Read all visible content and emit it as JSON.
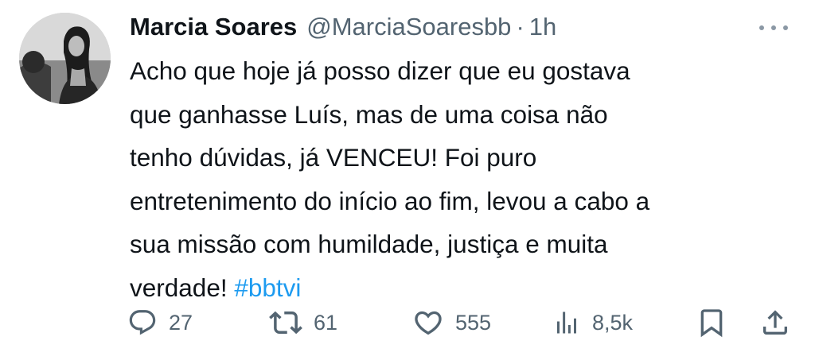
{
  "tweet": {
    "author_name": "Marcia Soares",
    "handle": "@MarciaSoaresbb",
    "separator": "·",
    "time": "1h",
    "text_lines": [
      "Acho que hoje já posso dizer que eu gostava",
      "que ganhasse Luís, mas de uma coisa não",
      "tenho dúvidas, já VENCEU! Foi puro",
      "entretenimento do início ao fim, levou a cabo a",
      "sua missão com humildade, justiça e muita",
      "verdade! "
    ],
    "hashtag": "#bbtvi"
  },
  "actions": {
    "replies": "27",
    "retweets": "61",
    "likes": "555",
    "views": "8,5k"
  },
  "icons": {
    "more": "more-horizontal-icon",
    "reply": "reply-icon",
    "retweet": "retweet-icon",
    "like": "heart-icon",
    "views": "views-icon",
    "bookmark": "bookmark-icon",
    "share": "share-icon"
  },
  "colors": {
    "text": "#0f1419",
    "secondary": "#536471",
    "link": "#1d9bf0"
  }
}
